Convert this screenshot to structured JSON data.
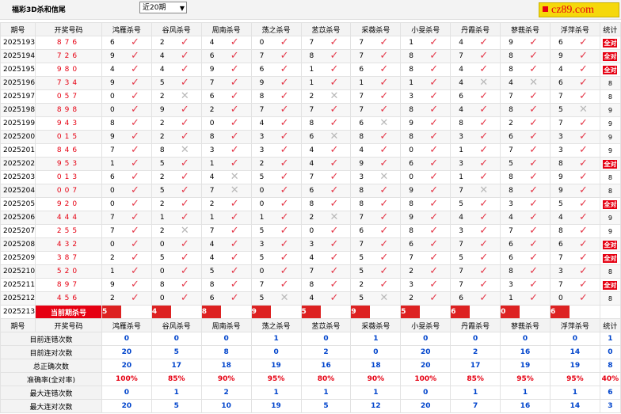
{
  "header": {
    "title": "福彩3D杀和信尾",
    "period_select": "近20期",
    "logo_text": "cz89.com"
  },
  "columns": [
    "期号",
    "开奖号码",
    "鸿雁杀号",
    "谷风杀号",
    "周南杀号",
    "荡之杀号",
    "苤苡杀号",
    "采薇杀号",
    "小旻杀号",
    "丹霞杀号",
    "蓼莪杀号",
    "浮萍杀号",
    "统计"
  ],
  "rows": [
    {
      "issue": "2025193",
      "win": "876",
      "c": [
        [
          "6",
          1
        ],
        [
          "2",
          1
        ],
        [
          "4",
          1
        ],
        [
          "0",
          1
        ],
        [
          "7",
          1
        ],
        [
          "7",
          1
        ],
        [
          "1",
          1
        ],
        [
          "4",
          1
        ],
        [
          "9",
          1
        ],
        [
          "6",
          1
        ]
      ],
      "stat": "全对"
    },
    {
      "issue": "2025194",
      "win": "726",
      "c": [
        [
          "9",
          1
        ],
        [
          "4",
          1
        ],
        [
          "6",
          1
        ],
        [
          "7",
          1
        ],
        [
          "8",
          1
        ],
        [
          "7",
          1
        ],
        [
          "8",
          1
        ],
        [
          "7",
          1
        ],
        [
          "8",
          1
        ],
        [
          "9",
          1
        ]
      ],
      "stat": "全对"
    },
    {
      "issue": "2025195",
      "win": "980",
      "c": [
        [
          "4",
          1
        ],
        [
          "4",
          1
        ],
        [
          "9",
          1
        ],
        [
          "6",
          1
        ],
        [
          "1",
          1
        ],
        [
          "6",
          1
        ],
        [
          "8",
          1
        ],
        [
          "4",
          1
        ],
        [
          "8",
          1
        ],
        [
          "4",
          1
        ]
      ],
      "stat": "全对"
    },
    {
      "issue": "2025196",
      "win": "734",
      "c": [
        [
          "9",
          1
        ],
        [
          "5",
          1
        ],
        [
          "7",
          1
        ],
        [
          "9",
          1
        ],
        [
          "1",
          1
        ],
        [
          "1",
          1
        ],
        [
          "1",
          1
        ],
        [
          "4",
          0
        ],
        [
          "4",
          0
        ],
        [
          "6",
          1
        ]
      ],
      "stat": "8"
    },
    {
      "issue": "2025197",
      "win": "057",
      "c": [
        [
          "0",
          1
        ],
        [
          "2",
          0
        ],
        [
          "6",
          1
        ],
        [
          "8",
          1
        ],
        [
          "2",
          0
        ],
        [
          "7",
          1
        ],
        [
          "3",
          1
        ],
        [
          "6",
          1
        ],
        [
          "7",
          1
        ],
        [
          "7",
          1
        ]
      ],
      "stat": "8"
    },
    {
      "issue": "2025198",
      "win": "898",
      "c": [
        [
          "0",
          1
        ],
        [
          "9",
          1
        ],
        [
          "2",
          1
        ],
        [
          "7",
          1
        ],
        [
          "7",
          1
        ],
        [
          "7",
          1
        ],
        [
          "8",
          1
        ],
        [
          "4",
          1
        ],
        [
          "8",
          1
        ],
        [
          "5",
          0
        ]
      ],
      "stat": "9"
    },
    {
      "issue": "2025199",
      "win": "943",
      "c": [
        [
          "8",
          1
        ],
        [
          "2",
          1
        ],
        [
          "0",
          1
        ],
        [
          "4",
          1
        ],
        [
          "8",
          1
        ],
        [
          "6",
          0
        ],
        [
          "9",
          1
        ],
        [
          "8",
          1
        ],
        [
          "2",
          1
        ],
        [
          "7",
          1
        ]
      ],
      "stat": "9"
    },
    {
      "issue": "2025200",
      "win": "015",
      "c": [
        [
          "9",
          1
        ],
        [
          "2",
          1
        ],
        [
          "8",
          1
        ],
        [
          "3",
          1
        ],
        [
          "6",
          0
        ],
        [
          "8",
          1
        ],
        [
          "8",
          1
        ],
        [
          "3",
          1
        ],
        [
          "6",
          1
        ],
        [
          "3",
          1
        ]
      ],
      "stat": "9"
    },
    {
      "issue": "2025201",
      "win": "846",
      "c": [
        [
          "7",
          1
        ],
        [
          "8",
          0
        ],
        [
          "3",
          1
        ],
        [
          "3",
          1
        ],
        [
          "4",
          1
        ],
        [
          "4",
          1
        ],
        [
          "0",
          1
        ],
        [
          "1",
          1
        ],
        [
          "7",
          1
        ],
        [
          "3",
          1
        ]
      ],
      "stat": "9"
    },
    {
      "issue": "2025202",
      "win": "953",
      "c": [
        [
          "1",
          1
        ],
        [
          "5",
          1
        ],
        [
          "1",
          1
        ],
        [
          "2",
          1
        ],
        [
          "4",
          1
        ],
        [
          "9",
          1
        ],
        [
          "6",
          1
        ],
        [
          "3",
          1
        ],
        [
          "5",
          1
        ],
        [
          "8",
          1
        ]
      ],
      "stat": "全对"
    },
    {
      "issue": "2025203",
      "win": "013",
      "c": [
        [
          "6",
          1
        ],
        [
          "2",
          1
        ],
        [
          "4",
          0
        ],
        [
          "5",
          1
        ],
        [
          "7",
          1
        ],
        [
          "3",
          0
        ],
        [
          "0",
          1
        ],
        [
          "1",
          1
        ],
        [
          "8",
          1
        ],
        [
          "9",
          1
        ]
      ],
      "stat": "8"
    },
    {
      "issue": "2025204",
      "win": "007",
      "c": [
        [
          "0",
          1
        ],
        [
          "5",
          1
        ],
        [
          "7",
          0
        ],
        [
          "0",
          1
        ],
        [
          "6",
          1
        ],
        [
          "8",
          1
        ],
        [
          "9",
          1
        ],
        [
          "7",
          0
        ],
        [
          "8",
          1
        ],
        [
          "9",
          1
        ]
      ],
      "stat": "8"
    },
    {
      "issue": "2025205",
      "win": "920",
      "c": [
        [
          "0",
          1
        ],
        [
          "2",
          1
        ],
        [
          "2",
          1
        ],
        [
          "0",
          1
        ],
        [
          "8",
          1
        ],
        [
          "8",
          1
        ],
        [
          "8",
          1
        ],
        [
          "5",
          1
        ],
        [
          "3",
          1
        ],
        [
          "5",
          1
        ]
      ],
      "stat": "全对"
    },
    {
      "issue": "2025206",
      "win": "444",
      "c": [
        [
          "7",
          1
        ],
        [
          "1",
          1
        ],
        [
          "1",
          1
        ],
        [
          "1",
          1
        ],
        [
          "2",
          0
        ],
        [
          "7",
          1
        ],
        [
          "9",
          1
        ],
        [
          "4",
          1
        ],
        [
          "4",
          1
        ],
        [
          "4",
          1
        ]
      ],
      "stat": "9"
    },
    {
      "issue": "2025207",
      "win": "255",
      "c": [
        [
          "7",
          1
        ],
        [
          "2",
          0
        ],
        [
          "7",
          1
        ],
        [
          "5",
          1
        ],
        [
          "0",
          1
        ],
        [
          "6",
          1
        ],
        [
          "8",
          1
        ],
        [
          "3",
          1
        ],
        [
          "7",
          1
        ],
        [
          "8",
          1
        ]
      ],
      "stat": "9"
    },
    {
      "issue": "2025208",
      "win": "432",
      "c": [
        [
          "0",
          1
        ],
        [
          "0",
          1
        ],
        [
          "4",
          1
        ],
        [
          "3",
          1
        ],
        [
          "3",
          1
        ],
        [
          "7",
          1
        ],
        [
          "6",
          1
        ],
        [
          "7",
          1
        ],
        [
          "6",
          1
        ],
        [
          "6",
          1
        ]
      ],
      "stat": "全对"
    },
    {
      "issue": "2025209",
      "win": "387",
      "c": [
        [
          "2",
          1
        ],
        [
          "5",
          1
        ],
        [
          "4",
          1
        ],
        [
          "5",
          1
        ],
        [
          "4",
          1
        ],
        [
          "5",
          1
        ],
        [
          "7",
          1
        ],
        [
          "5",
          1
        ],
        [
          "6",
          1
        ],
        [
          "7",
          1
        ]
      ],
      "stat": "全对"
    },
    {
      "issue": "2025210",
      "win": "520",
      "c": [
        [
          "1",
          1
        ],
        [
          "0",
          1
        ],
        [
          "5",
          1
        ],
        [
          "0",
          1
        ],
        [
          "7",
          1
        ],
        [
          "5",
          1
        ],
        [
          "2",
          1
        ],
        [
          "7",
          1
        ],
        [
          "8",
          1
        ],
        [
          "3",
          1
        ]
      ],
      "stat": "8"
    },
    {
      "issue": "2025211",
      "win": "897",
      "c": [
        [
          "9",
          1
        ],
        [
          "8",
          1
        ],
        [
          "8",
          1
        ],
        [
          "7",
          1
        ],
        [
          "8",
          1
        ],
        [
          "2",
          1
        ],
        [
          "3",
          1
        ],
        [
          "7",
          1
        ],
        [
          "3",
          1
        ],
        [
          "7",
          1
        ]
      ],
      "stat": "全对"
    },
    {
      "issue": "2025212",
      "win": "456",
      "c": [
        [
          "2",
          1
        ],
        [
          "0",
          1
        ],
        [
          "6",
          1
        ],
        [
          "5",
          0
        ],
        [
          "4",
          1
        ],
        [
          "5",
          0
        ],
        [
          "2",
          1
        ],
        [
          "6",
          1
        ],
        [
          "1",
          1
        ],
        [
          "0",
          1
        ]
      ],
      "stat": "8"
    }
  ],
  "current": {
    "issue": "2025213",
    "label": "当前期杀号",
    "kills": [
      "5",
      "4",
      "8",
      "9",
      "5",
      "9",
      "5",
      "6",
      "0",
      "6"
    ]
  },
  "stats": {
    "header": [
      "期号",
      "开奖号码",
      "鸿雁杀号",
      "谷风杀号",
      "周南杀号",
      "荡之杀号",
      "苤苡杀号",
      "采薇杀号",
      "小旻杀号",
      "丹霞杀号",
      "蓼莪杀号",
      "浮萍杀号",
      "统计"
    ],
    "rows": [
      {
        "label": "目前连错次数",
        "v": [
          "0",
          "0",
          "0",
          "1",
          "0",
          "1",
          "0",
          "0",
          "0",
          "0",
          "1"
        ],
        "red": false
      },
      {
        "label": "目前连对次数",
        "v": [
          "20",
          "5",
          "8",
          "0",
          "2",
          "0",
          "20",
          "2",
          "16",
          "14",
          "0"
        ],
        "red": false
      },
      {
        "label": "总正确次数",
        "v": [
          "20",
          "17",
          "18",
          "19",
          "16",
          "18",
          "20",
          "17",
          "19",
          "19",
          "8"
        ],
        "red": false
      },
      {
        "label": "准确率(全对率)",
        "v": [
          "100%",
          "85%",
          "90%",
          "95%",
          "80%",
          "90%",
          "100%",
          "85%",
          "95%",
          "95%",
          "40%"
        ],
        "red": true
      },
      {
        "label": "最大连错次数",
        "v": [
          "0",
          "1",
          "2",
          "1",
          "1",
          "1",
          "0",
          "1",
          "1",
          "1",
          "6"
        ],
        "red": false
      },
      {
        "label": "最大连对次数",
        "v": [
          "20",
          "5",
          "10",
          "19",
          "5",
          "12",
          "20",
          "7",
          "16",
          "14",
          "3"
        ],
        "red": false
      }
    ]
  },
  "colors": {
    "accent": "#e60012",
    "check": "#e4394a",
    "cross": "#b8b8b8",
    "stat_value": "#0044cc",
    "logo_bg": "#f5d80a"
  }
}
